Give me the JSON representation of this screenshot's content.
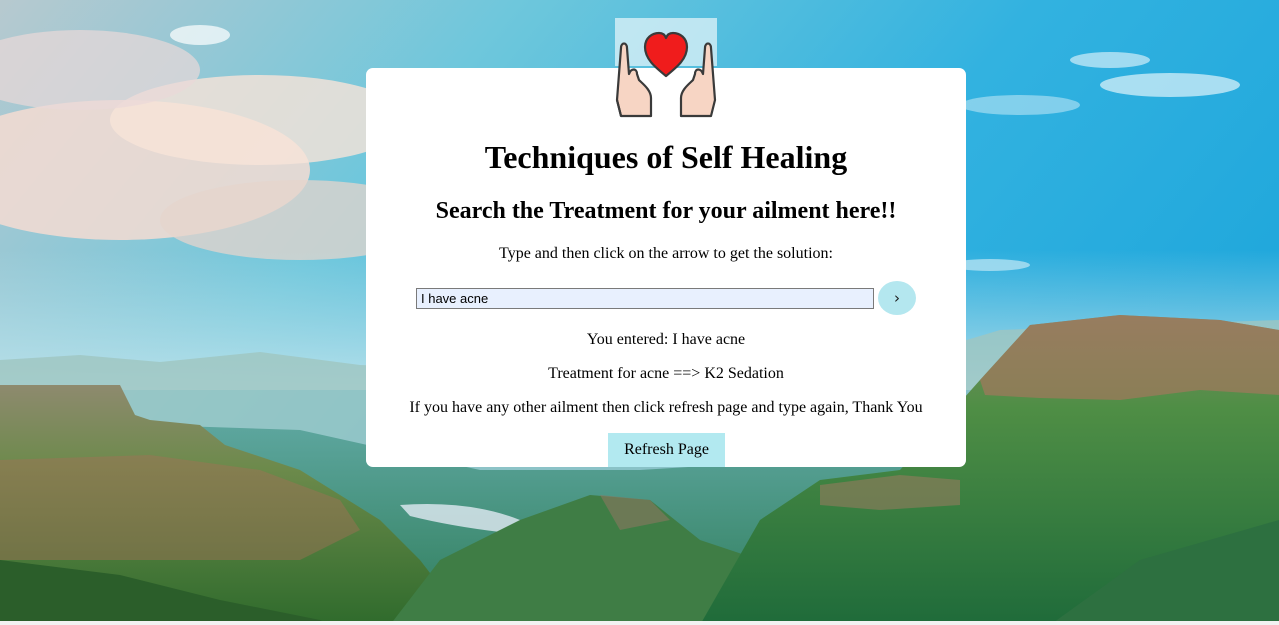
{
  "header": {
    "title": "Techniques of Self Healing",
    "subtitle": "Search the Treatment for your ailment here!!",
    "instruction": "Type and then click on the arrow to get the solution:"
  },
  "search": {
    "value": "I have acne",
    "submit_label": "›"
  },
  "results": {
    "entered": "You entered: I have acne",
    "treatment": "Treatment for acne ==> K2 Sedation",
    "note": "If you have any other ailment then click refresh page and type again, Thank You"
  },
  "actions": {
    "refresh_label": "Refresh Page"
  },
  "icons": {
    "logo": "hands-holding-heart-icon"
  },
  "colors": {
    "card_background": "#ffffff",
    "input_background": "#e8f0fe",
    "button_background": "#b2e9f0",
    "heart": "#f01c1c",
    "sky": "#39b6e2"
  }
}
